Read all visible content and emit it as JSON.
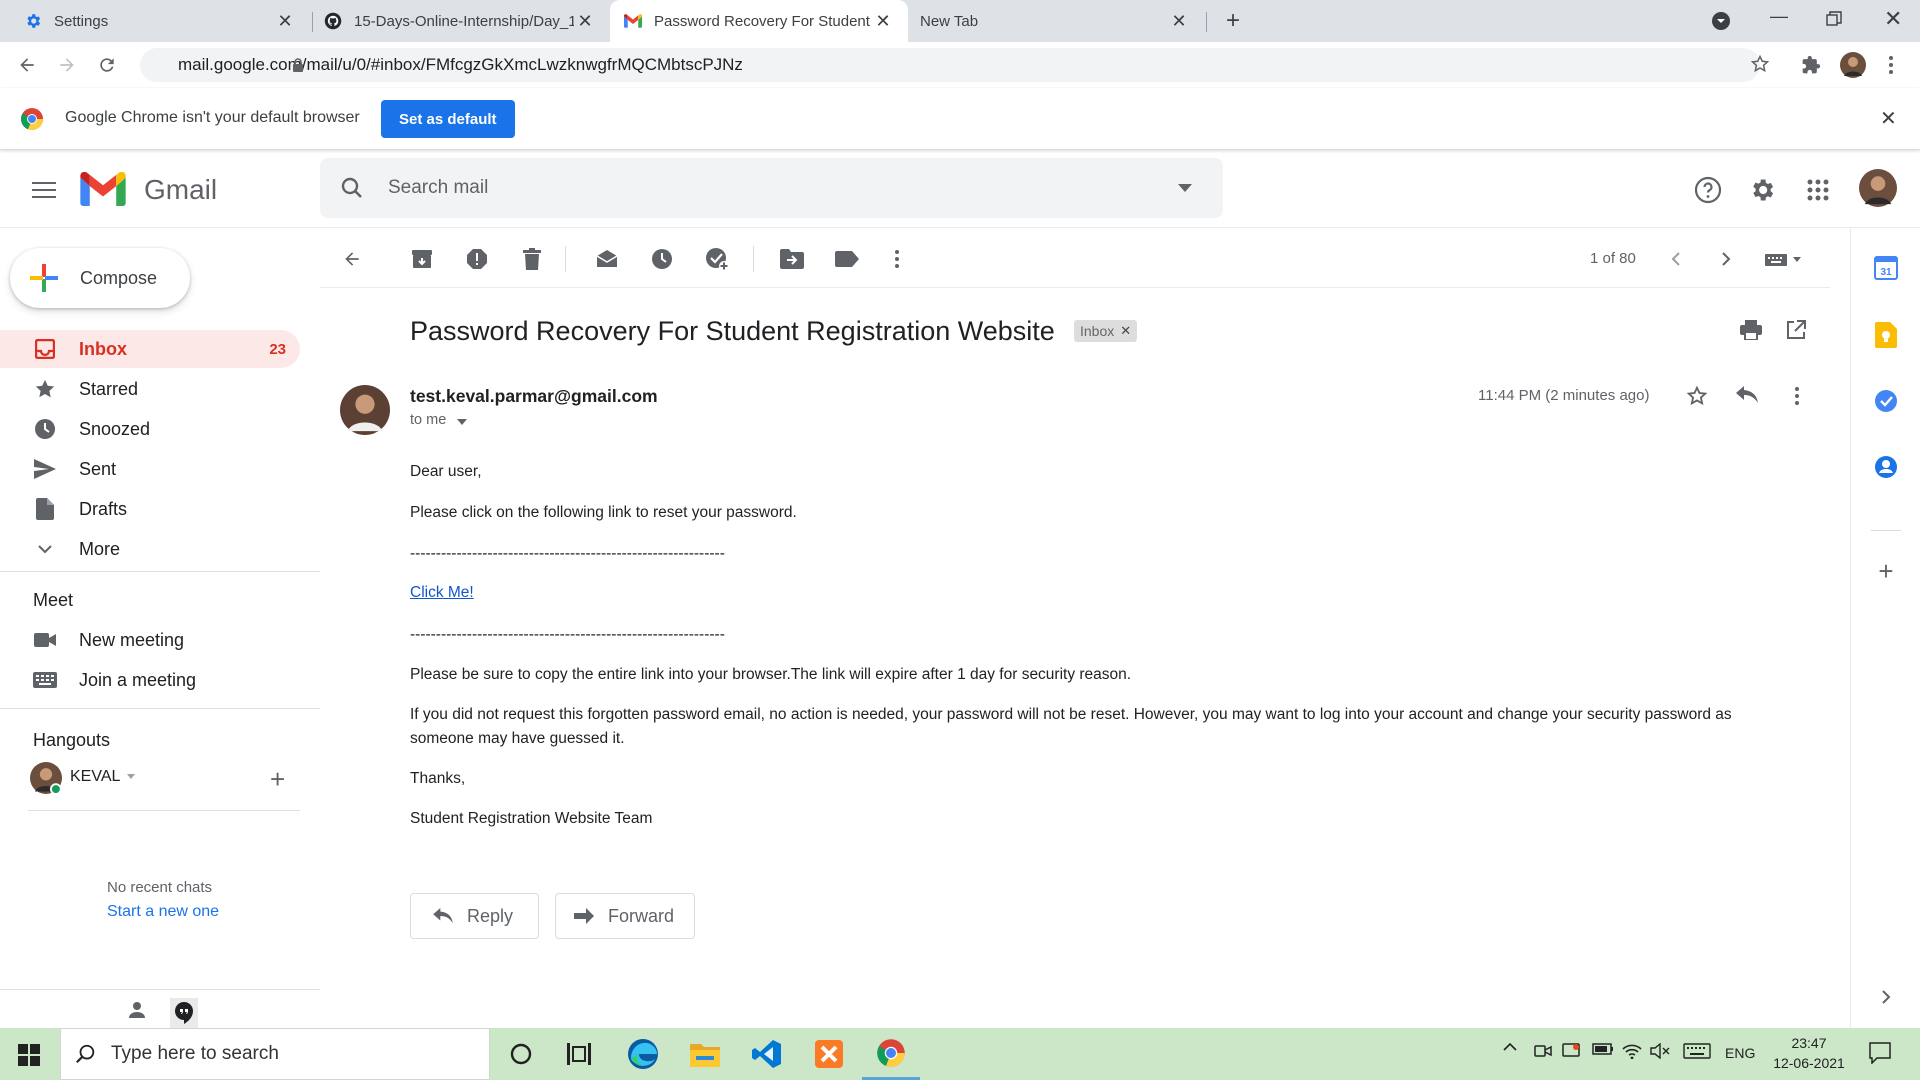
{
  "browser": {
    "tabs": [
      {
        "title": "Settings",
        "icon": "gear-icon"
      },
      {
        "title": "15-Days-Online-Internship/Day_1",
        "icon": "github-icon"
      },
      {
        "title": "Password Recovery For Student R",
        "icon": "gmail-icon"
      },
      {
        "title": "New Tab",
        "icon": ""
      }
    ],
    "url": "mail.google.com/mail/u/0/#inbox/FMfcgzGkXmcLwzknwgfrMQCMbtscPJNz"
  },
  "infobar": {
    "message": "Google Chrome isn't your default browser",
    "button": "Set as default"
  },
  "gmail": {
    "logo_text": "Gmail",
    "search_placeholder": "Search mail",
    "compose": "Compose",
    "nav": [
      {
        "label": "Inbox",
        "count": "23"
      },
      {
        "label": "Starred"
      },
      {
        "label": "Snoozed"
      },
      {
        "label": "Sent"
      },
      {
        "label": "Drafts"
      },
      {
        "label": "More"
      }
    ],
    "meet": {
      "heading": "Meet",
      "items": [
        "New meeting",
        "Join a meeting"
      ]
    },
    "hangouts": {
      "heading": "Hangouts",
      "user": "KEVAL",
      "no_chats": "No recent chats",
      "start_new": "Start a new one"
    },
    "pager": "1 of 80"
  },
  "email": {
    "subject": "Password Recovery For Student Registration Website",
    "label": "Inbox",
    "sender": "test.keval.parmar@gmail.com",
    "to": "to me",
    "time": "11:44 PM (2 minutes ago)",
    "body": {
      "greeting": "Dear user,",
      "line1": "Please click on the following link to reset your password.",
      "separator": "-------------------------------------------------------------",
      "link": "Click Me!",
      "line2": "Please be sure to copy the entire link into your browser.The link will expire after 1 day for security reason.",
      "line3a": "If you did not request this forgotten password email, no action is needed, your password will not be reset. However, you may want to log into your account and change your security password as",
      "line3b": "someone may have guessed it.",
      "thanks": "Thanks,",
      "signature": "Student Registration Website Team"
    },
    "reply": "Reply",
    "forward": "Forward"
  },
  "taskbar": {
    "search_placeholder": "Type here to search",
    "lang": "ENG",
    "time": "23:47",
    "date": "12-06-2021"
  },
  "colors": {
    "accent": "#1a73e8",
    "gmail_red": "#d93025",
    "taskbar": "#cce6c8"
  }
}
